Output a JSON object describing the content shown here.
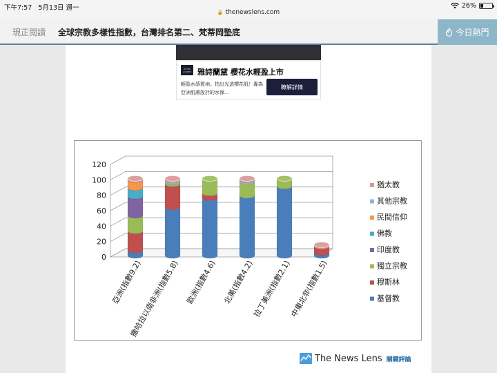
{
  "statusbar": {
    "time": "下午7:57",
    "date": "5月13日 週一",
    "url": "thenewslens.com",
    "battery_text": "26%",
    "battery_level": 0.26
  },
  "header": {
    "now_reading": "現正閱讀",
    "title": "全球宗教多樣性指數，台灣排名第二、梵蒂岡墊底",
    "hot_label": "今日熱門"
  },
  "ad": {
    "headline": "雅詩蘭黛 櫻花水輕盈上市",
    "desc": "輕盈水感質地，拍出光透櫻花肌！專為亞洲肌膚設計的水保...",
    "cta": "瞭解詳情",
    "logo_text": "ESTEE LAUDER"
  },
  "chart_data": {
    "type": "bar",
    "stacked": true,
    "categories": [
      "亞洲(指數9.2)",
      "撒哈拉以南非洲(指數5.8)",
      "歐洲(指數4.6)",
      "北美(指數4.2)",
      "拉丁美洲(指數2.1)",
      "中東北非(指數1.5)"
    ],
    "ylim": [
      0,
      120
    ],
    "yticks": [
      0,
      20,
      40,
      60,
      80,
      100,
      120
    ],
    "grid": true,
    "legend_position": "right",
    "series": [
      {
        "name": "基督教",
        "color": "#4a7ebb",
        "values": [
          7,
          63,
          75,
          78,
          90,
          4
        ]
      },
      {
        "name": "穆斯林",
        "color": "#c0504d",
        "values": [
          25,
          30,
          6,
          0,
          0,
          8
        ]
      },
      {
        "name": "獨立宗教",
        "color": "#9bbb59",
        "values": [
          20,
          3,
          19,
          18,
          10,
          0
        ]
      },
      {
        "name": "印度教",
        "color": "#8064a2",
        "values": [
          25,
          0,
          0,
          0,
          0,
          0
        ]
      },
      {
        "name": "佛教",
        "color": "#4bacc6",
        "values": [
          11,
          0,
          0,
          0,
          0,
          0
        ]
      },
      {
        "name": "民間信仰",
        "color": "#f79646",
        "values": [
          10,
          0,
          0,
          0,
          0,
          0
        ]
      },
      {
        "name": "其他宗教",
        "color": "#95b3d7",
        "values": [
          0,
          2,
          0,
          2,
          0,
          0
        ]
      },
      {
        "name": "猶太教",
        "color": "#d99694",
        "values": [
          2,
          2,
          0,
          2,
          0,
          2
        ]
      }
    ]
  },
  "brand": {
    "name": "The News Lens",
    "sub": "關鍵評論"
  }
}
